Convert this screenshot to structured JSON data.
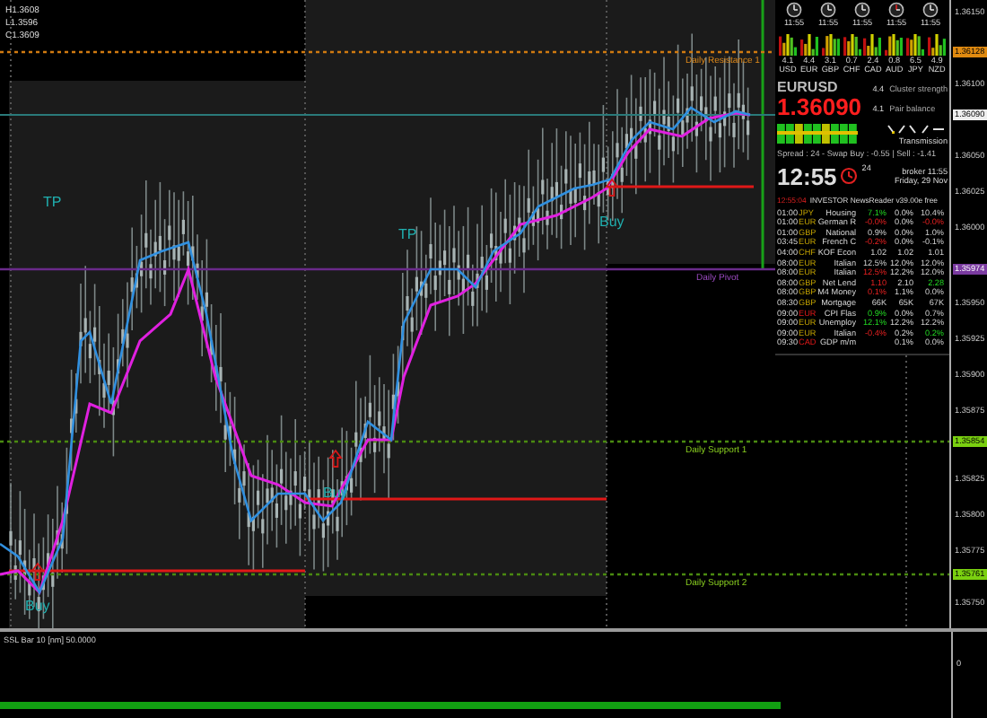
{
  "chart": {
    "ohlc": [
      "H1.3608",
      "L1.3596",
      "C1.3609"
    ],
    "levels": [
      {
        "label": "Daily Resistance 1",
        "kind": "resistance"
      },
      {
        "label": "Daily Pivot",
        "kind": "pivot"
      },
      {
        "label": "Daily Support 1",
        "kind": "support"
      },
      {
        "label": "Daily Support 2",
        "kind": "support"
      }
    ],
    "signals": [
      {
        "text": "Buy",
        "kind": "buy"
      },
      {
        "text": "Buy",
        "kind": "buy"
      },
      {
        "text": "Buy",
        "kind": "buy"
      },
      {
        "text": "TP",
        "kind": "tp"
      },
      {
        "text": "TP",
        "kind": "tp"
      }
    ]
  },
  "price_axis": [
    {
      "text": "1.36150",
      "kind": "tick"
    },
    {
      "text": "1.36128",
      "kind": "resistance"
    },
    {
      "text": "1.36100",
      "kind": "tick"
    },
    {
      "text": "1.36090",
      "kind": "current"
    },
    {
      "text": "1.36050",
      "kind": "tick"
    },
    {
      "text": "1.36025",
      "kind": "tick"
    },
    {
      "text": "1.36000",
      "kind": "tick"
    },
    {
      "text": "1.35974",
      "kind": "pivot"
    },
    {
      "text": "1.35950",
      "kind": "tick"
    },
    {
      "text": "1.35925",
      "kind": "tick"
    },
    {
      "text": "1.35900",
      "kind": "tick"
    },
    {
      "text": "1.35875",
      "kind": "tick"
    },
    {
      "text": "1.35854",
      "kind": "support"
    },
    {
      "text": "1.35825",
      "kind": "tick"
    },
    {
      "text": "1.35800",
      "kind": "tick"
    },
    {
      "text": "1.35775",
      "kind": "tick"
    },
    {
      "text": "1.35761",
      "kind": "support"
    },
    {
      "text": "1.35750",
      "kind": "tick"
    }
  ],
  "dashboard": {
    "clocks": [
      {
        "time": "11:55",
        "alert": false
      },
      {
        "time": "11:55",
        "alert": false
      },
      {
        "time": "11:55",
        "alert": false
      },
      {
        "time": "11:55",
        "alert": true
      },
      {
        "time": "11:55",
        "alert": false
      }
    ],
    "strength": [
      {
        "value": "4.1",
        "currency": "USD"
      },
      {
        "value": "4.4",
        "currency": "EUR"
      },
      {
        "value": "3.1",
        "currency": "GBP"
      },
      {
        "value": "0.7",
        "currency": "CHF"
      },
      {
        "value": "2.4",
        "currency": "CAD"
      },
      {
        "value": "0.8",
        "currency": "AUD"
      },
      {
        "value": "6.5",
        "currency": "JPY"
      },
      {
        "value": "4.9",
        "currency": "NZD"
      }
    ],
    "symbol": "EURUSD",
    "price": "1.36090",
    "readings": [
      "4.4",
      "4.1"
    ],
    "cluster_label": "Cluster strength",
    "balance_label": "Pair balance",
    "transmission": "Transmission",
    "spread": "Spread : 24 - Swap Buy : -0.55 | Sell : -1.41",
    "clock_time": "12:55",
    "clock_seconds": "24",
    "broker": "broker  11:55",
    "date": "Friday, 29 Nov",
    "news_time": "12:55:04",
    "news_title": "INVESTOR NewsReader v39.00e free",
    "news": [
      {
        "time": "01:00",
        "currency": "JPY",
        "high_impact": false,
        "event": "Housing",
        "actual": "7.1%",
        "actual_positive": true,
        "actual_negative": false,
        "forecast": "0.0%",
        "previous": "10.4%",
        "previous_positive": false,
        "previous_negative": false
      },
      {
        "time": "01:00",
        "currency": "EUR",
        "high_impact": false,
        "event": "German R",
        "actual": "-0.0%",
        "actual_positive": false,
        "actual_negative": true,
        "forecast": "0.0%",
        "previous": "-0.0%",
        "previous_positive": false,
        "previous_negative": true
      },
      {
        "time": "01:00",
        "currency": "GBP",
        "high_impact": false,
        "event": "National",
        "actual": "0.9%",
        "actual_positive": false,
        "actual_negative": false,
        "forecast": "0.0%",
        "previous": "1.0%",
        "previous_positive": false,
        "previous_negative": false
      },
      {
        "time": "03:45",
        "currency": "EUR",
        "high_impact": false,
        "event": "French C",
        "actual": "-0.2%",
        "actual_positive": false,
        "actual_negative": true,
        "forecast": "0.0%",
        "previous": "-0.1%",
        "previous_positive": false,
        "previous_negative": false
      },
      {
        "time": "04:00",
        "currency": "CHF",
        "high_impact": false,
        "event": "KOF Econ",
        "actual": "1.02",
        "actual_positive": false,
        "actual_negative": false,
        "forecast": "1.02",
        "previous": "1.01",
        "previous_positive": false,
        "previous_negative": false
      },
      {
        "time": "08:00",
        "currency": "EUR",
        "high_impact": false,
        "event": "Italian",
        "actual": "12.5%",
        "actual_positive": false,
        "actual_negative": false,
        "forecast": "12.0%",
        "previous": "12.0%",
        "previous_positive": false,
        "previous_negative": false
      },
      {
        "time": "08:00",
        "currency": "EUR",
        "high_impact": false,
        "event": "Italian",
        "actual": "12.5%",
        "actual_positive": false,
        "actual_negative": true,
        "forecast": "12.2%",
        "previous": "12.0%",
        "previous_positive": false,
        "previous_negative": false
      },
      {
        "time": "08:00",
        "currency": "GBP",
        "high_impact": false,
        "event": "Net Lend",
        "actual": "1.10",
        "actual_positive": false,
        "actual_negative": true,
        "forecast": "2.10",
        "previous": "2.28",
        "previous_positive": true,
        "previous_negative": false
      },
      {
        "time": "08:00",
        "currency": "GBP",
        "high_impact": false,
        "event": "M4 Money",
        "actual": "0.1%",
        "actual_positive": false,
        "actual_negative": true,
        "forecast": "1.1%",
        "previous": "0.0%",
        "previous_positive": false,
        "previous_negative": false
      },
      {
        "time": "08:30",
        "currency": "GBP",
        "high_impact": false,
        "event": "Mortgage",
        "actual": "66K",
        "actual_positive": false,
        "actual_negative": false,
        "forecast": "65K",
        "previous": "67K",
        "previous_positive": false,
        "previous_negative": false
      },
      {
        "time": "09:00",
        "currency": "EUR",
        "high_impact": true,
        "event": "CPI Flas",
        "actual": "0.9%",
        "actual_positive": true,
        "actual_negative": false,
        "forecast": "0.0%",
        "previous": "0.7%",
        "previous_positive": false,
        "previous_negative": false
      },
      {
        "time": "09:00",
        "currency": "EUR",
        "high_impact": false,
        "event": "Unemploy",
        "actual": "12.1%",
        "actual_positive": true,
        "actual_negative": false,
        "forecast": "12.2%",
        "previous": "12.2%",
        "previous_positive": false,
        "previous_negative": false
      },
      {
        "time": "09:00",
        "currency": "EUR",
        "high_impact": false,
        "event": "Italian",
        "actual": "-0.4%",
        "actual_positive": false,
        "actual_negative": true,
        "forecast": "0.2%",
        "previous": "0.2%",
        "previous_positive": true,
        "previous_negative": false
      },
      {
        "time": "09:30",
        "currency": "CAD",
        "high_impact": true,
        "event": "GDP m/m",
        "forecast": "0.1%",
        "previous": "0.0%",
        "previous_positive": false,
        "previous_negative": false
      }
    ]
  },
  "indicator": {
    "label": "SSL Bar 10 [nm] 50.0000",
    "axis": "0"
  }
}
